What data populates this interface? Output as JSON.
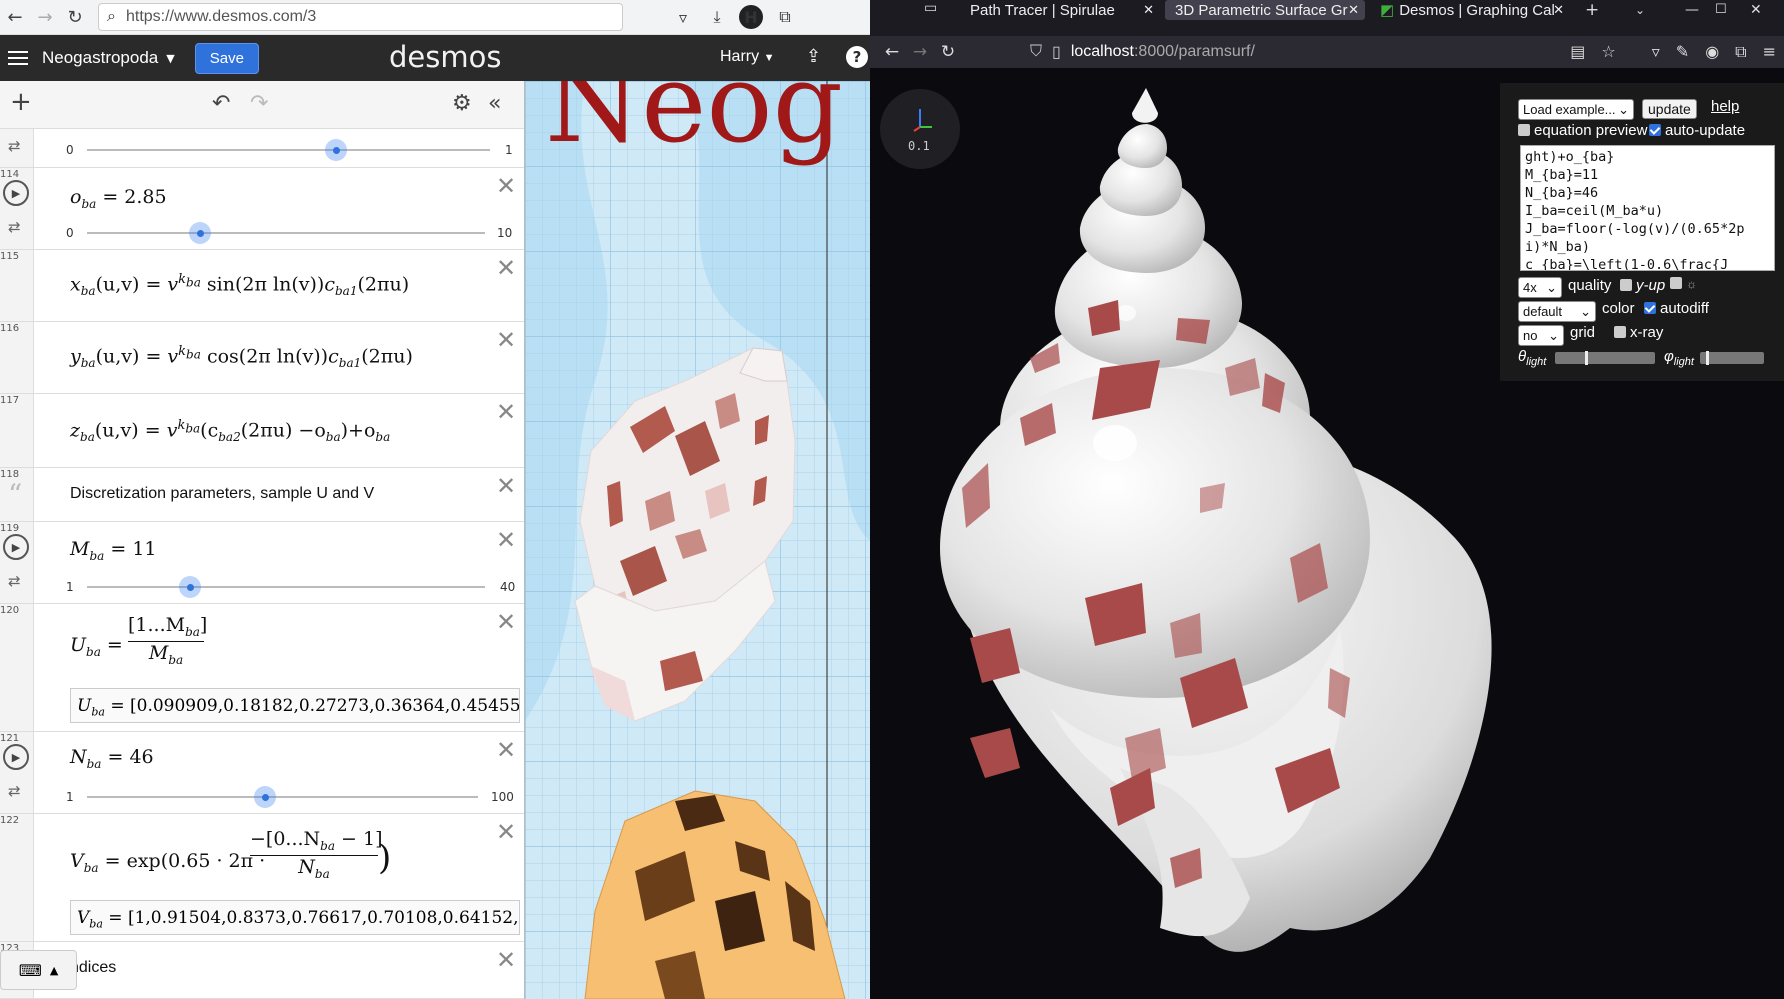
{
  "left_browser": {
    "url": "https://www.desmos.com/3"
  },
  "desmos": {
    "graph_name": "Neogastropoda",
    "save_label": "Save",
    "logo": "desmos",
    "user": "Harry",
    "help": "?",
    "graph_title_fragment": "Neog",
    "keyboard_label": "keyboard"
  },
  "expressions": {
    "e113": {
      "num": "",
      "min": "0",
      "max": "1",
      "value": 0.55
    },
    "e114": {
      "num": "114",
      "var": "o",
      "sub": "ba",
      "value_text": "2.85",
      "min": "0",
      "max": "10",
      "value": 0.285
    },
    "e115": {
      "num": "115",
      "lhs": "x",
      "sub": "ba",
      "args": "(u,v)",
      "exp": "k",
      "exp_sub": "ba",
      "fn": "sin",
      "inner": "(2π ln(v))",
      "c": "c",
      "c_sub": "ba1",
      "tail": "(2πu)"
    },
    "e116": {
      "num": "116",
      "lhs": "y",
      "sub": "ba",
      "args": "(u,v)",
      "exp": "k",
      "exp_sub": "ba",
      "fn": "cos",
      "inner": "(2π ln(v))",
      "c": "c",
      "c_sub": "ba1",
      "tail": "(2πu)"
    },
    "e117": {
      "num": "117",
      "lhs": "z",
      "sub": "ba",
      "args": "(u,v)",
      "exp": "k",
      "exp_sub": "ba",
      "inner": "(c",
      "c_sub": "ba2",
      "mid": "(2πu) −o",
      "o_sub": "ba",
      "tail": ")+o",
      "tail_sub": "ba"
    },
    "e118": {
      "num": "118",
      "text": "Discretization parameters, sample U and V"
    },
    "e119": {
      "num": "119",
      "var": "M",
      "sub": "ba",
      "value_text": "11",
      "min": "1",
      "max": "40",
      "value": 0.2564
    },
    "e120": {
      "num": "120",
      "var": "U",
      "sub": "ba",
      "numer": "[1...M",
      "numer_sub": "ba",
      "numer_end": "]",
      "denom": "M",
      "denom_sub": "ba",
      "list": "[0.090909,0.18182,0.27273,0.36364,0.45455,0.5"
    },
    "e121": {
      "num": "121",
      "var": "N",
      "sub": "ba",
      "value_text": "46",
      "min": "1",
      "max": "100",
      "value": 0.4545
    },
    "e122": {
      "num": "122",
      "var": "V",
      "sub": "ba",
      "expr_a": "exp(0.65 · 2π ·",
      "numer": "−[0...N",
      "numer_sub": "ba",
      "numer_end": " − 1]",
      "denom": "N",
      "denom_sub": "ba",
      "expr_b": ")",
      "list": "[1,0.91504,0.8373,0.76617,0.70108,0.64152,0.58"
    },
    "e123": {
      "num": "123",
      "text": "ndices"
    }
  },
  "right_browser": {
    "tabs": [
      "Path Tracer | Spirulae",
      "3D Parametric Surface Gr",
      "Desmos | Graphing Cal"
    ],
    "url_host": "localhost",
    "url_path": ":8000/paramsurf/",
    "axes_scale": "0.1"
  },
  "controls": {
    "example_select": "Load example...",
    "update_label": "update",
    "help_label": "help",
    "equation_preview_label": "equation preview",
    "auto_update_label": "auto-update",
    "code": "ght)+o_{ba}\nM_{ba}=11\nN_{ba}=46\nI_ba=ceil(M_ba*u)\nJ_ba=floor(-log(v)/(0.65*2p\ni)*N_ba)\nc_{ba}=\\left(1-0.6\\frac{J_",
    "quality_select": "4x",
    "quality_label": "quality",
    "yup_label": "y-up",
    "sun_label": "☼",
    "color_select": "default",
    "color_label": "color",
    "autodiff_label": "autodiff",
    "grid_select": "no",
    "grid_label": "grid",
    "xray_label": "x-ray",
    "theta_label": "θ",
    "theta_sub": "light",
    "phi_label": "φ",
    "phi_sub": "light",
    "theta_value": 0.3,
    "phi_value": 0.1
  },
  "colors": {
    "desmos_header": "#2a2a2a",
    "save_blue": "#2f72dc",
    "slider_knob": "#2f72dc",
    "shell_white": "#e8e8e8",
    "shell_band": "#a04545",
    "graph_bg": "#cfe9f7",
    "firefox_dark": "#1c1b22"
  }
}
